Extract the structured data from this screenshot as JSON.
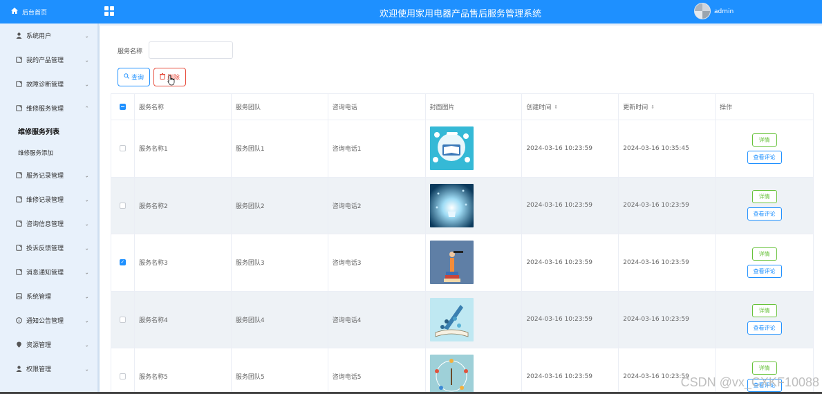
{
  "app": {
    "title": "欢迎使用家用电器产品售后服务管理系统",
    "user": "admin",
    "brand_color": "#1e90ff"
  },
  "sidebar": {
    "home_label": "后台首页",
    "items": [
      {
        "label": "系统用户",
        "icon": "user-icon"
      },
      {
        "label": "我的产品管理",
        "icon": "doc-icon"
      },
      {
        "label": "故障诊断管理",
        "icon": "doc-icon"
      },
      {
        "label": "维修服务管理",
        "icon": "doc-icon"
      },
      {
        "label": "服务记录管理",
        "icon": "doc-icon"
      },
      {
        "label": "维修记录管理",
        "icon": "doc-icon"
      },
      {
        "label": "咨询信息管理",
        "icon": "doc-icon"
      },
      {
        "label": "投诉反馈管理",
        "icon": "doc-icon"
      },
      {
        "label": "消息通知管理",
        "icon": "doc-icon"
      },
      {
        "label": "系统管理",
        "icon": "picture-icon"
      },
      {
        "label": "通知公告管理",
        "icon": "info-icon"
      },
      {
        "label": "资源管理",
        "icon": "location-icon"
      },
      {
        "label": "权限管理",
        "icon": "user-icon"
      }
    ],
    "sub_items": {
      "active": "维修服务列表",
      "other": "维修服务添加"
    }
  },
  "search": {
    "label": "服务名称",
    "value": "",
    "query_button": "查询",
    "delete_button": "删除"
  },
  "table": {
    "headers": {
      "name": "服务名称",
      "team": "服务团队",
      "phone": "咨询电话",
      "cover": "封面图片",
      "created": "创建时间",
      "updated": "更新时间",
      "ops": "操作"
    },
    "rows": [
      {
        "name": "服务名称1",
        "team": "服务团队1",
        "phone": "咨询电话1",
        "created": "2024-03-16 10:23:59",
        "updated": "2024-03-16 10:35:45",
        "checked": false
      },
      {
        "name": "服务名称2",
        "team": "服务团队2",
        "phone": "咨询电话2",
        "created": "2024-03-16 10:23:59",
        "updated": "2024-03-16 10:23:59",
        "checked": false
      },
      {
        "name": "服务名称3",
        "team": "服务团队3",
        "phone": "咨询电话3",
        "created": "2024-03-16 10:23:59",
        "updated": "2024-03-16 10:23:59",
        "checked": true
      },
      {
        "name": "服务名称4",
        "team": "服务团队4",
        "phone": "咨询电话4",
        "created": "2024-03-16 10:23:59",
        "updated": "2024-03-16 10:23:59",
        "checked": false
      },
      {
        "name": "服务名称5",
        "team": "服务团队5",
        "phone": "咨询电话5",
        "created": "2024-03-16 10:23:59",
        "updated": "2024-03-16 10:23:59",
        "checked": false
      }
    ],
    "detail_label": "详情",
    "review_label": "查看评论"
  },
  "watermark": "CSDN @vx_CXKF10088"
}
